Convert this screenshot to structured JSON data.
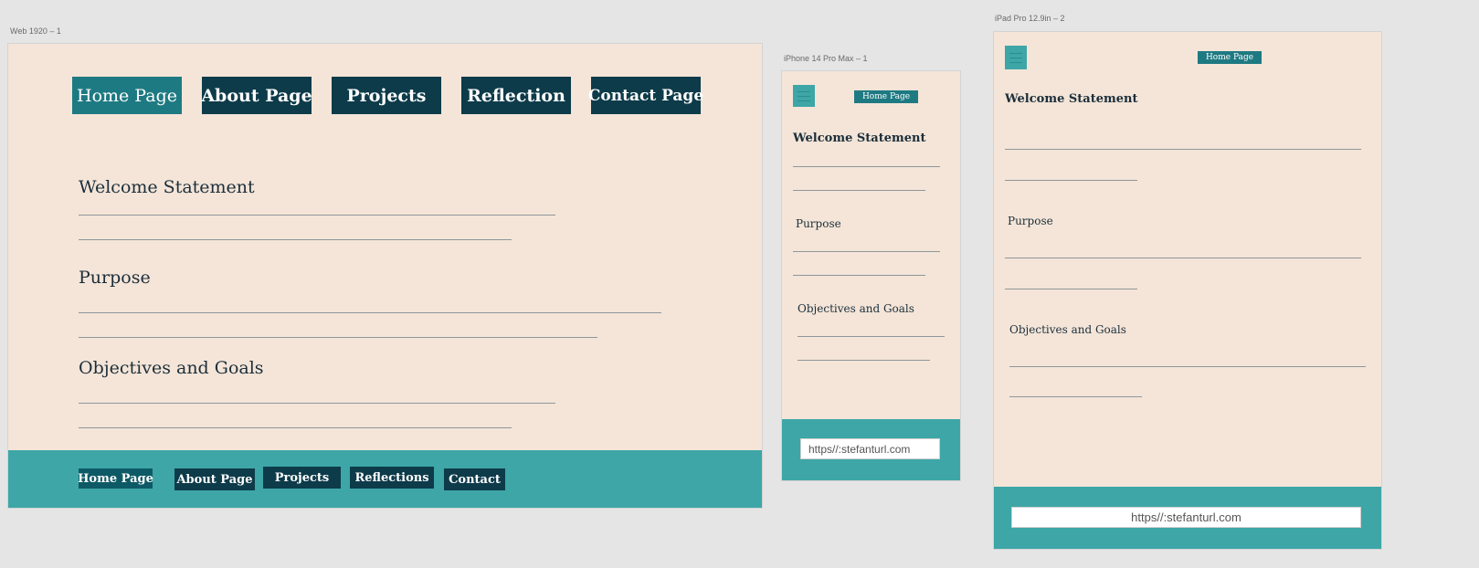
{
  "artboards": {
    "web": {
      "label": "Web 1920 – 1",
      "nav": [
        "Home Page",
        "About Page",
        "Projects",
        "Reflection",
        "Contact Page"
      ],
      "sections": [
        "Welcome Statement",
        "Purpose",
        "Objectives and Goals"
      ],
      "footer_nav": [
        "Home Page",
        "About Page",
        "Projects",
        "Reflections",
        "Contact"
      ]
    },
    "iphone": {
      "label": "iPhone 14 Pro Max – 1",
      "nav_button": "Home Page",
      "menu_icon": "hamburger-menu-icon",
      "sections": [
        "Welcome Statement",
        "Purpose",
        "Objectives and Goals"
      ],
      "footer_url": "https//:stefanturl.com"
    },
    "ipad": {
      "label": "iPad Pro 12.9in – 2",
      "nav_button": "Home Page",
      "menu_icon": "hamburger-menu-icon",
      "sections": [
        "Welcome Statement",
        "Purpose",
        "Objectives and Goals"
      ],
      "footer_url": "https//:stefanturl.com"
    }
  },
  "colors": {
    "page_bg": "#e5e5e5",
    "artboard_bg": "#f4e5d8",
    "nav_dark": "#0d3b4a",
    "nav_active": "#1e7a82",
    "footer_teal": "#3ea6a7"
  }
}
